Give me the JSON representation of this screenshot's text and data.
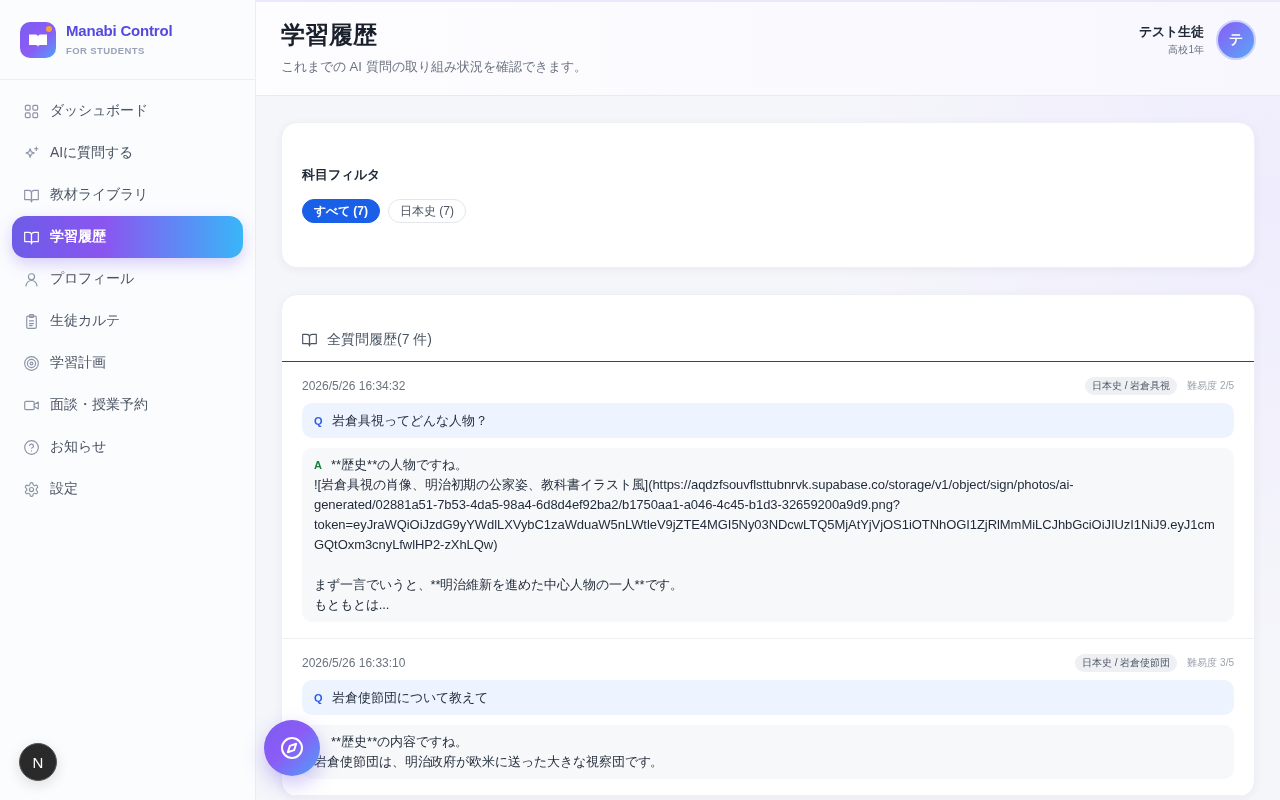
{
  "sidebar": {
    "brand": {
      "name": "Manabi Control",
      "tagline": "FOR STUDENTS"
    },
    "items": [
      {
        "label": "ダッシュボード",
        "selected": false
      },
      {
        "label": "AIに質問する",
        "selected": false
      },
      {
        "label": "教材ライブラリ",
        "selected": false
      },
      {
        "label": "学習履歴",
        "selected": true
      },
      {
        "label": "プロフィール",
        "selected": false
      },
      {
        "label": "生徒カルテ",
        "selected": false
      },
      {
        "label": "学習計画",
        "selected": false
      },
      {
        "label": "面談・授業予約",
        "selected": false
      },
      {
        "label": "お知らせ",
        "selected": false
      },
      {
        "label": "設定",
        "selected": false
      }
    ]
  },
  "header": {
    "title": "学習履歴",
    "subtitle": "これまでの AI 質問の取り組み状況を確認できます。",
    "user": {
      "name": "テスト生徒",
      "grade": "高校1年",
      "avatar": "テ"
    }
  },
  "filter": {
    "title": "科目フィルタ",
    "options": [
      {
        "label": "すべて (7)",
        "selected": true
      },
      {
        "label": "日本史 (7)",
        "selected": false
      }
    ]
  },
  "history": {
    "title": "全質問履歴(7 件)",
    "entries": [
      {
        "timestamp": "2026/5/26 16:34:32",
        "tag": "日本史 / 岩倉具視",
        "difficulty": "難易度 2/5",
        "question": {
          "label": "Q",
          "text": "岩倉具視ってどんな人物？"
        },
        "answer": {
          "label": "A",
          "paragraphs": [
            [
              "**歴史**の人物ですね。",
              "![岩倉具視の肖像、明治初期の公家姿、教科書イラスト風](https://aqdzfsouvflsttubnrvk.supabase.co/storage/v1/object/sign/photos/ai-",
              "generated/02881a51-7b53-4da5-98a4-6d8d4ef92ba2/b1750aa1-a046-4c45-b1d3-32659200a9d9.png?",
              "token=eyJraWQiOiJzdG9yYWdlLXVybC1zaWduaW5nLWtleV9jZTE4MGI5Ny03NDcwLTQ5MjAtYjVjOS1iOTNhOGI1ZjRlMmMiLCJhbGciOiJIUzI1NiJ9.eyJ1cm",
              "GQtOxm3cnyLfwlHP2-zXhLQw)"
            ],
            [
              "まず一言でいうと、**明治維新を進めた中心人物の一人**です。",
              "もともとは..."
            ]
          ]
        }
      },
      {
        "timestamp": "2026/5/26 16:33:10",
        "tag": "日本史 / 岩倉使節団",
        "difficulty": "難易度 3/5",
        "question": {
          "label": "Q",
          "text": "岩倉使節団について教えて"
        },
        "answer": {
          "paragraphs": [
            [
              "**歴史**の内容ですね。",
              "岩倉使節団は、明治政府が欧米に送った大きな視察団です。"
            ]
          ]
        }
      }
    ]
  },
  "dev_indicator": {
    "label": "N"
  }
}
